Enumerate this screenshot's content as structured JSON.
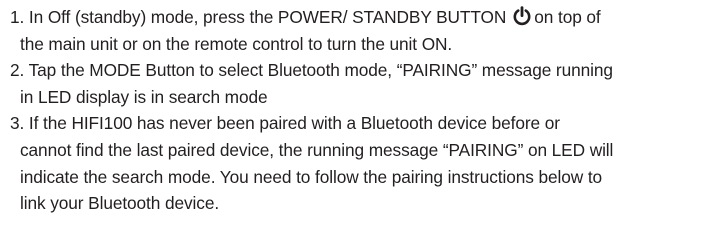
{
  "instructions": {
    "step1": {
      "line1_before_icon": "1. In Off (standby) mode, press the POWER/ STANDBY BUTTON",
      "icon": "power-icon",
      "line1_after_icon": "on top of",
      "line2": "the main unit or on the remote control to turn the unit ON."
    },
    "step2": {
      "line1": "2.  Tap the MODE Button to select Bluetooth mode, “PAIRING” message running",
      "line2": "in LED display is in search mode"
    },
    "step3": {
      "line1": "3.  If the HIFI100 has never been paired with a Bluetooth device before or",
      "line2": "cannot find the last paired device, the running message “PAIRING” on LED will",
      "line3": "indicate the search mode. You need to follow the pairing instructions below to",
      "line4": "link your Bluetooth device."
    }
  },
  "colors": {
    "text": "#231f20",
    "background": "#ffffff"
  }
}
